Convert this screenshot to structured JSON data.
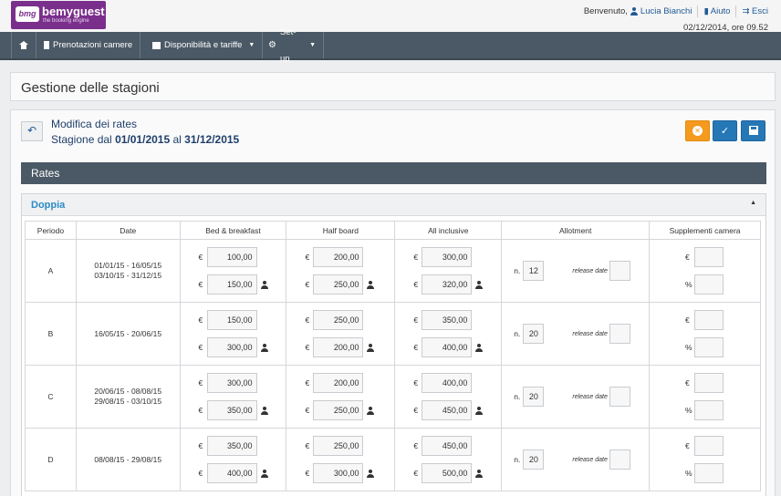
{
  "header": {
    "logo_badge": "bmg",
    "logo_name": "bemyguest",
    "logo_tagline": "the booking engine",
    "welcome": "Benvenuto,",
    "user": "Lucia Bianchi",
    "help": "Aiuto",
    "exit": "Esci",
    "datetime": "02/12/2014, ore 09.52"
  },
  "nav": {
    "items": [
      {
        "label": "Prenotazioni camere"
      },
      {
        "label": "Disponibilità e tariffe"
      },
      {
        "label": "Set-up"
      }
    ]
  },
  "page": {
    "title": "Gestione delle stagioni",
    "mod_title": "Modifica dei rates",
    "season_prefix": "Stagione dal",
    "season_from": "01/01/2015",
    "season_mid": "al",
    "season_to": "31/12/2015",
    "rates_bar": "Rates",
    "room": "Doppia"
  },
  "table": {
    "headers": [
      "Periodo",
      "Date",
      "Bed & breakfast",
      "Half board",
      "All inclusive",
      "Allotment",
      "Supplementi camera"
    ],
    "currency": "€",
    "n_label": "n.",
    "release_label": "release date",
    "percent": "%",
    "rows": [
      {
        "period": "A",
        "date1": "01/01/15 - 16/05/15",
        "date2": "03/10/15 - 31/12/15",
        "bb": [
          "100,00",
          "150,00"
        ],
        "hb": [
          "200,00",
          "250,00"
        ],
        "ai": [
          "300,00",
          "320,00"
        ],
        "n": "12"
      },
      {
        "period": "B",
        "date1": "16/05/15 - 20/06/15",
        "date2": "",
        "bb": [
          "150,00",
          "300,00"
        ],
        "hb": [
          "250,00",
          "200,00"
        ],
        "ai": [
          "350,00",
          "400,00"
        ],
        "n": "20"
      },
      {
        "period": "C",
        "date1": "20/06/15 - 08/08/15",
        "date2": "29/08/15 - 03/10/15",
        "bb": [
          "300,00",
          "350,00"
        ],
        "hb": [
          "200,00",
          "250,00"
        ],
        "ai": [
          "400,00",
          "450,00"
        ],
        "n": "20"
      },
      {
        "period": "D",
        "date1": "08/08/15 - 29/08/15",
        "date2": "",
        "bb": [
          "350,00",
          "400,00"
        ],
        "hb": [
          "250,00",
          "300,00"
        ],
        "ai": [
          "450,00",
          "500,00"
        ],
        "n": "20"
      }
    ]
  }
}
